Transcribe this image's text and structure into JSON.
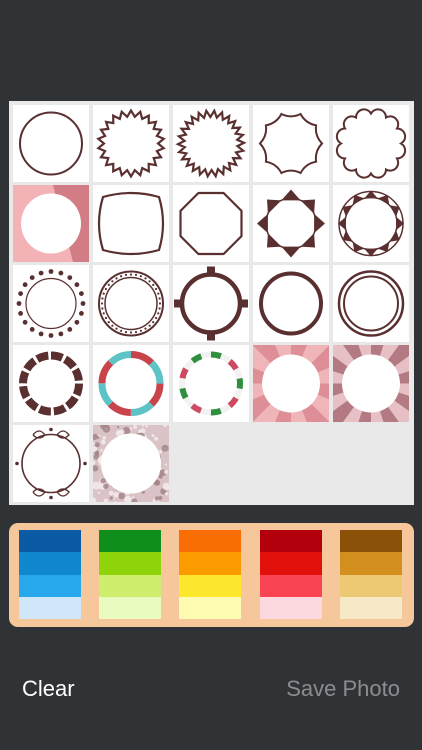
{
  "frames": [
    {
      "name": "circle-frame"
    },
    {
      "name": "sunburst-frame"
    },
    {
      "name": "starburst-frame"
    },
    {
      "name": "decagon-frame"
    },
    {
      "name": "scalloped-frame"
    },
    {
      "name": "pink-square-frame"
    },
    {
      "name": "rounded-square-frame"
    },
    {
      "name": "octagon-frame"
    },
    {
      "name": "triangle-ring-frame"
    },
    {
      "name": "spiked-ring-frame"
    },
    {
      "name": "dotted-ring-frame"
    },
    {
      "name": "beaded-ring-frame"
    },
    {
      "name": "tabbed-ring-frame"
    },
    {
      "name": "thick-ring-frame"
    },
    {
      "name": "double-ring-frame"
    },
    {
      "name": "dashed-ring-frame"
    },
    {
      "name": "red-teal-ring-frame"
    },
    {
      "name": "green-pink-ring-frame"
    },
    {
      "name": "pink-rays-frame"
    },
    {
      "name": "mauve-rays-frame"
    },
    {
      "name": "ornate-frame"
    },
    {
      "name": "glitter-frame"
    }
  ],
  "palettes": [
    {
      "name": "blue",
      "colors": [
        "#0a5aa6",
        "#1187cf",
        "#27a7ec",
        "#cfe6fb"
      ]
    },
    {
      "name": "green",
      "colors": [
        "#0f8e1b",
        "#8fd40b",
        "#cfee6e",
        "#e9fbbe"
      ]
    },
    {
      "name": "orange",
      "colors": [
        "#fa6d02",
        "#fb9b00",
        "#fde72c",
        "#fefbb2"
      ]
    },
    {
      "name": "red",
      "colors": [
        "#b2000d",
        "#e2100b",
        "#fb4453",
        "#fbd9de"
      ]
    },
    {
      "name": "gold",
      "colors": [
        "#8c5108",
        "#d4901e",
        "#ecc972",
        "#f7e9c7"
      ]
    }
  ],
  "frame_color": "#5a2f2f",
  "buttons": {
    "clear": "Clear",
    "save": "Save Photo"
  }
}
